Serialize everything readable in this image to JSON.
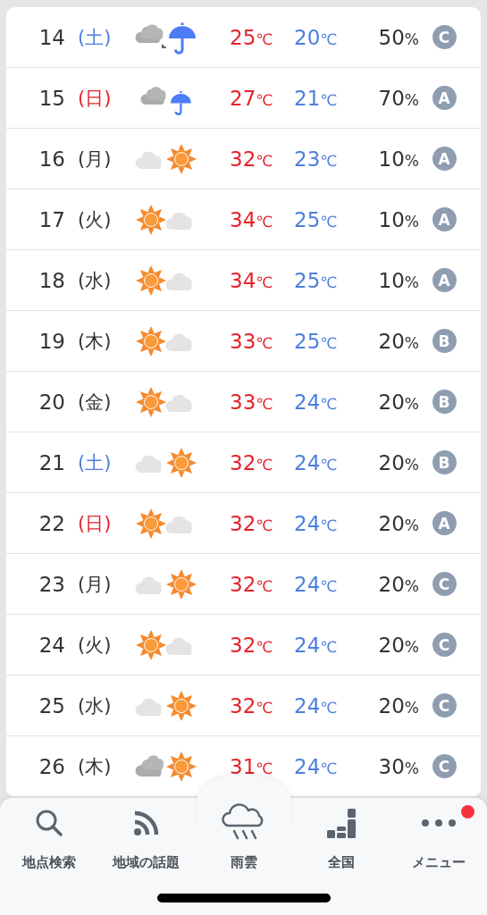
{
  "forecast": [
    {
      "date": "14",
      "weekday": "(土)",
      "color": "#4d7fdc",
      "kind": "cloudy_then_rain",
      "high": "25",
      "high_unit": "℃",
      "low": "20",
      "low_unit": "℃",
      "precip": "50",
      "precip_unit": "%",
      "grade": "C"
    },
    {
      "date": "15",
      "weekday": "(日)",
      "color": "#e5232b",
      "kind": "cloudy_rain",
      "high": "27",
      "high_unit": "℃",
      "low": "21",
      "low_unit": "℃",
      "precip": "70",
      "precip_unit": "%",
      "grade": "A"
    },
    {
      "date": "16",
      "weekday": "(月)",
      "color": "#333333",
      "kind": "cloud_sun",
      "high": "32",
      "high_unit": "℃",
      "low": "23",
      "low_unit": "℃",
      "precip": "10",
      "precip_unit": "%",
      "grade": "A"
    },
    {
      "date": "17",
      "weekday": "(火)",
      "color": "#333333",
      "kind": "sun_cloud",
      "high": "34",
      "high_unit": "℃",
      "low": "25",
      "low_unit": "℃",
      "precip": "10",
      "precip_unit": "%",
      "grade": "A"
    },
    {
      "date": "18",
      "weekday": "(水)",
      "color": "#333333",
      "kind": "sun_cloud",
      "high": "34",
      "high_unit": "℃",
      "low": "25",
      "low_unit": "℃",
      "precip": "10",
      "precip_unit": "%",
      "grade": "A"
    },
    {
      "date": "19",
      "weekday": "(木)",
      "color": "#333333",
      "kind": "sun_cloud",
      "high": "33",
      "high_unit": "℃",
      "low": "25",
      "low_unit": "℃",
      "precip": "20",
      "precip_unit": "%",
      "grade": "B"
    },
    {
      "date": "20",
      "weekday": "(金)",
      "color": "#333333",
      "kind": "sun_cloud",
      "high": "33",
      "high_unit": "℃",
      "low": "24",
      "low_unit": "℃",
      "precip": "20",
      "precip_unit": "%",
      "grade": "B"
    },
    {
      "date": "21",
      "weekday": "(土)",
      "color": "#4d7fdc",
      "kind": "cloud_sun",
      "high": "32",
      "high_unit": "℃",
      "low": "24",
      "low_unit": "℃",
      "precip": "20",
      "precip_unit": "%",
      "grade": "B"
    },
    {
      "date": "22",
      "weekday": "(日)",
      "color": "#e5232b",
      "kind": "sun_cloud",
      "high": "32",
      "high_unit": "℃",
      "low": "24",
      "low_unit": "℃",
      "precip": "20",
      "precip_unit": "%",
      "grade": "A"
    },
    {
      "date": "23",
      "weekday": "(月)",
      "color": "#333333",
      "kind": "cloud_sun",
      "high": "32",
      "high_unit": "℃",
      "low": "24",
      "low_unit": "℃",
      "precip": "20",
      "precip_unit": "%",
      "grade": "C"
    },
    {
      "date": "24",
      "weekday": "(火)",
      "color": "#333333",
      "kind": "sun_cloud",
      "high": "32",
      "high_unit": "℃",
      "low": "24",
      "low_unit": "℃",
      "precip": "20",
      "precip_unit": "%",
      "grade": "C"
    },
    {
      "date": "25",
      "weekday": "(水)",
      "color": "#333333",
      "kind": "cloud_sun",
      "high": "32",
      "high_unit": "℃",
      "low": "24",
      "low_unit": "℃",
      "precip": "20",
      "precip_unit": "%",
      "grade": "C"
    },
    {
      "date": "26",
      "weekday": "(木)",
      "color": "#333333",
      "kind": "cloudy_sun",
      "high": "31",
      "high_unit": "℃",
      "low": "24",
      "low_unit": "℃",
      "precip": "30",
      "precip_unit": "%",
      "grade": "C"
    }
  ],
  "tab_bar": [
    {
      "kind": "search",
      "label": "地点検索",
      "notification": false
    },
    {
      "kind": "feed",
      "label": "地域の話題",
      "notification": false
    },
    {
      "kind": "rain",
      "label": "雨雲",
      "notification": false
    },
    {
      "kind": "nation",
      "label": "全国",
      "notification": false
    },
    {
      "kind": "menu",
      "label": "メニュー",
      "notification": true
    }
  ]
}
